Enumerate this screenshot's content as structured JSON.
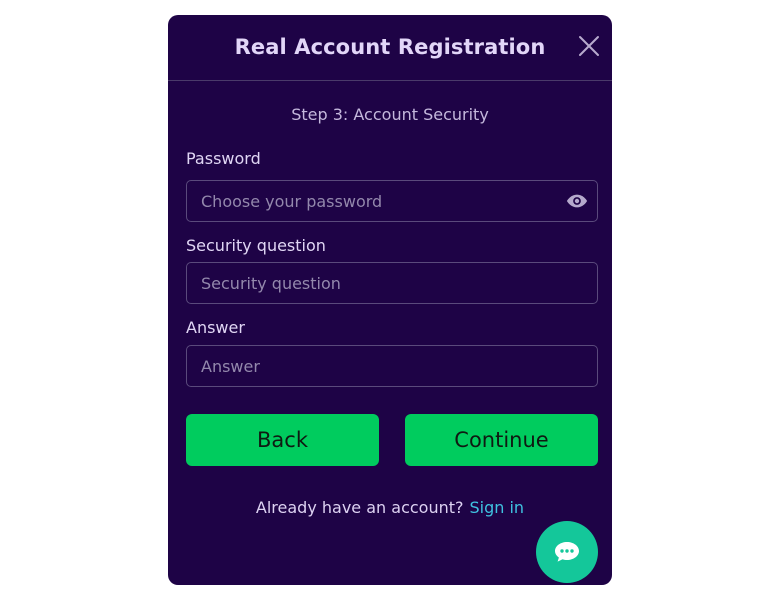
{
  "modal": {
    "title": "Real Account Registration",
    "step": "Step 3: Account Security"
  },
  "fields": {
    "password": {
      "label": "Password",
      "placeholder": "Choose your password",
      "value": ""
    },
    "security_question": {
      "label": "Security question",
      "placeholder": "Security question",
      "value": ""
    },
    "answer": {
      "label": "Answer",
      "placeholder": "Answer",
      "value": ""
    }
  },
  "buttons": {
    "back": "Back",
    "continue": "Continue"
  },
  "footer": {
    "prompt": "Already have an account?",
    "sign_in": "Sign in"
  },
  "icons": {
    "close": "close-icon",
    "eye": "eye-icon",
    "chat": "chat-bubble-icon"
  },
  "colors": {
    "modal_bg": "#1e0346",
    "primary_button": "#00cc5e",
    "link": "#3fc2e0",
    "chat_button": "#14c79a"
  }
}
